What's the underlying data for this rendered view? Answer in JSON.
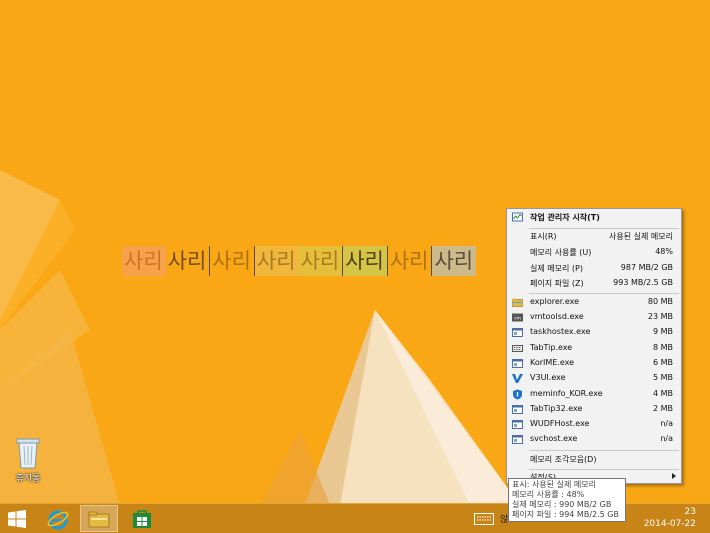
{
  "desktop": {
    "sari_text": [
      "사리",
      "사리",
      "사리",
      "사리",
      "사리",
      "사리",
      "사리",
      "사리"
    ],
    "recycle_bin_label": "휴지통"
  },
  "menu": {
    "task_manager": "작업 관리자 시작(T)",
    "display_label": "표시(R)",
    "display_value": "사용된 실제 메모리",
    "usage_label": "메모리 사용률 (U)",
    "usage_value": "48%",
    "physical_label": "실제 메모리 (P)",
    "physical_value": "987 MB/2 GB",
    "pagefile_label": "페이지 파일 (Z)",
    "pagefile_value": "993 MB/2.5 GB",
    "processes": [
      {
        "name": "explorer.exe",
        "value": "80 MB",
        "icon": "folder-icon"
      },
      {
        "name": "vmtoolsd.exe",
        "value": "23 MB",
        "icon": "vm-icon"
      },
      {
        "name": "taskhostex.exe",
        "value": "9 MB",
        "icon": "window-icon"
      },
      {
        "name": "TabTip.exe",
        "value": "8 MB",
        "icon": "keyboard-icon"
      },
      {
        "name": "KorIME.exe",
        "value": "6 MB",
        "icon": "window-icon"
      },
      {
        "name": "V3UI.exe",
        "value": "5 MB",
        "icon": "v3-icon"
      },
      {
        "name": "meminfo_KOR.exe",
        "value": "4 MB",
        "icon": "shield-icon"
      },
      {
        "name": "TabTip32.exe",
        "value": "2 MB",
        "icon": "window-icon"
      },
      {
        "name": "WUDFHost.exe",
        "value": "n/a",
        "icon": "window-icon"
      },
      {
        "name": "svchost.exe",
        "value": "n/a",
        "icon": "window-icon"
      }
    ],
    "defrag": "메모리 조각모음(D)",
    "settings": "설정(S)"
  },
  "tooltip": {
    "lines": [
      "표시: 사용된 실제 메모리",
      "메모리 사용률 : 48%",
      "실제 메모리 : 990 MB/2 GB",
      "페이지 파일 : 994 MB/2.5 GB"
    ]
  },
  "taskbar": {
    "tray_hint": "않",
    "clock_time": "23",
    "clock_date": "2014-07-22"
  },
  "colors": {
    "wallpaper": "#f9a715",
    "taskbar": "#c98417",
    "menu_bg": "#f2f2f2"
  }
}
